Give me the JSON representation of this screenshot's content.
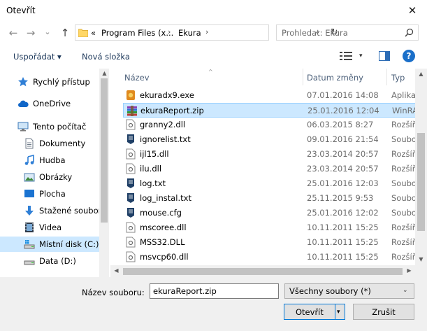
{
  "window": {
    "title": "Otevřít",
    "close": "✕"
  },
  "address": {
    "back": "←",
    "forward": "→",
    "recent": "⌄",
    "up": "↑",
    "crumbs": [
      "«",
      "Program Files (x...",
      "Ekura"
    ],
    "separators": [
      "›",
      "›"
    ],
    "dropdown": "⌄",
    "refresh": "↻"
  },
  "search": {
    "placeholder": "Prohledat: Ekura"
  },
  "toolbar": {
    "organize": "Uspořádat ▾",
    "new_folder": "Nová složka",
    "view_drop": "▾",
    "help": "?"
  },
  "nav": {
    "items": [
      {
        "label": "Rychlý přístup",
        "icon": "star-icon"
      },
      {
        "label": "OneDrive",
        "icon": "cloud-icon"
      },
      {
        "label": "Tento počítač",
        "icon": "computer-icon"
      },
      {
        "label": "Dokumenty",
        "icon": "documents-icon"
      },
      {
        "label": "Hudba",
        "icon": "music-icon"
      },
      {
        "label": "Obrázky",
        "icon": "pictures-icon"
      },
      {
        "label": "Plocha",
        "icon": "desktop-icon"
      },
      {
        "label": "Stažené soubory",
        "icon": "downloads-icon"
      },
      {
        "label": "Videa",
        "icon": "videos-icon"
      },
      {
        "label": "Místní disk (C:)",
        "icon": "drive-icon"
      },
      {
        "label": "Data (D:)",
        "icon": "drive-icon"
      }
    ]
  },
  "list": {
    "columns": {
      "name": "Název",
      "date": "Datum změny",
      "type": "Typ"
    },
    "sort_arrow": "^",
    "rows": [
      {
        "name": "ekuradx9.exe",
        "date": "07.01.2016 14:08",
        "type": "Aplika"
      },
      {
        "name": "ekuraReport.zip",
        "date": "25.01.2016 12:04",
        "type": "WinRA"
      },
      {
        "name": "granny2.dll",
        "date": "06.03.2015 8:27",
        "type": "Rozšíř"
      },
      {
        "name": "ignorelist.txt",
        "date": "09.01.2016 21:54",
        "type": "Soubo"
      },
      {
        "name": "ijl15.dll",
        "date": "23.03.2014 20:57",
        "type": "Rozšíř"
      },
      {
        "name": "ilu.dll",
        "date": "23.03.2014 20:57",
        "type": "Rozšíř"
      },
      {
        "name": "log.txt",
        "date": "25.01.2016 12:03",
        "type": "Soubo"
      },
      {
        "name": "log_instal.txt",
        "date": "25.11.2015 9:53",
        "type": "Soubo"
      },
      {
        "name": "mouse.cfg",
        "date": "25.01.2016 12:02",
        "type": "Soubo"
      },
      {
        "name": "mscoree.dll",
        "date": "10.11.2011 15:25",
        "type": "Rozšíř"
      },
      {
        "name": "MSS32.DLL",
        "date": "10.11.2011 15:25",
        "type": "Rozšíř"
      },
      {
        "name": "msvcp60.dll",
        "date": "10.11.2011 15:25",
        "type": "Rozšíř"
      }
    ]
  },
  "scroll": {
    "up": "▲",
    "down": "▼",
    "left": "◀",
    "right": "▶"
  },
  "bottom": {
    "filename_label": "Název souboru:",
    "filename_value": "ekuraReport.zip",
    "filter": "Všechny soubory (*)",
    "filter_drop": "⌄",
    "open": "Otevřít",
    "open_drop": "▾",
    "cancel": "Zrušit"
  }
}
